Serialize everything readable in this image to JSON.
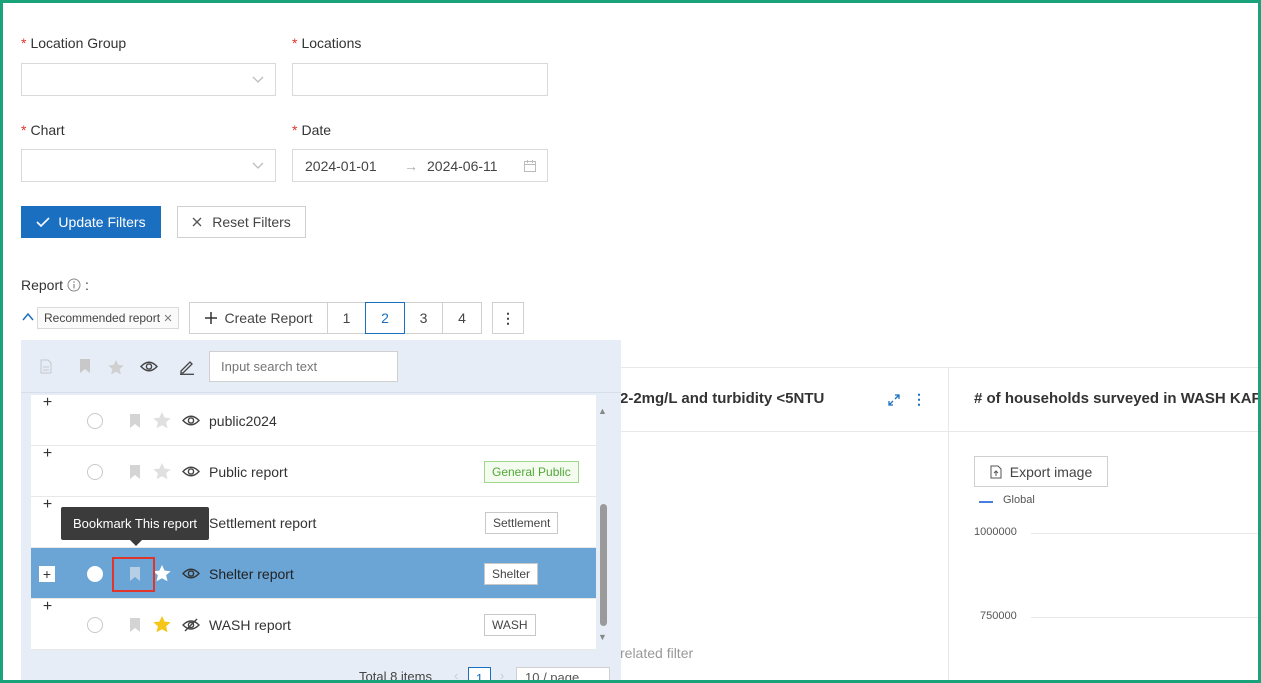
{
  "filters": {
    "location_group_label": "Location Group",
    "locations_label": "Locations",
    "chart_label": "Chart",
    "date_label": "Date",
    "required_mark": "*",
    "date_start": "2024-01-01",
    "date_end": "2024-06-11",
    "date_arrow": "→",
    "update_label": "Update Filters",
    "reset_label": "Reset Filters"
  },
  "report": {
    "label": "Report",
    "colon": ":",
    "recommended_tag": "Recommended report",
    "create_label": "Create Report",
    "pages": [
      "1",
      "2",
      "3",
      "4"
    ],
    "active_page": "2",
    "more": "⋮"
  },
  "panel": {
    "search_placeholder": "Input search text",
    "rows": [
      {
        "name": "public2024",
        "tag": "",
        "starred": false,
        "visible": true
      },
      {
        "name": "Public report",
        "tag": "General Public",
        "starred": false,
        "visible": true
      },
      {
        "name": "Settlement report",
        "tag": "Settlement",
        "starred": false,
        "visible": true
      },
      {
        "name": "Shelter report",
        "tag": "Shelter",
        "starred": false,
        "visible": true,
        "selected": true
      },
      {
        "name": "WASH report",
        "tag": "WASH",
        "starred": true,
        "visible": false
      }
    ],
    "tooltip": "Bookmark This report",
    "total": "Total 8 items",
    "current_page": "1",
    "page_size": "10 / page"
  },
  "charts": {
    "chart1_title": "2-2mg/L and turbidity <5NTU",
    "chart1_note": "related filter",
    "chart2_title": "# of households surveyed in WASH KAP",
    "export_label": "Export image",
    "legend_global": "Global",
    "tick_1": "1000000",
    "tick_2": "750000"
  },
  "colors": {
    "primary": "#1a6fc0",
    "selected_row": "#6aa5d6",
    "star_gold": "#f5c518",
    "frame": "#1aa37a",
    "highlight": "#e0352b"
  }
}
